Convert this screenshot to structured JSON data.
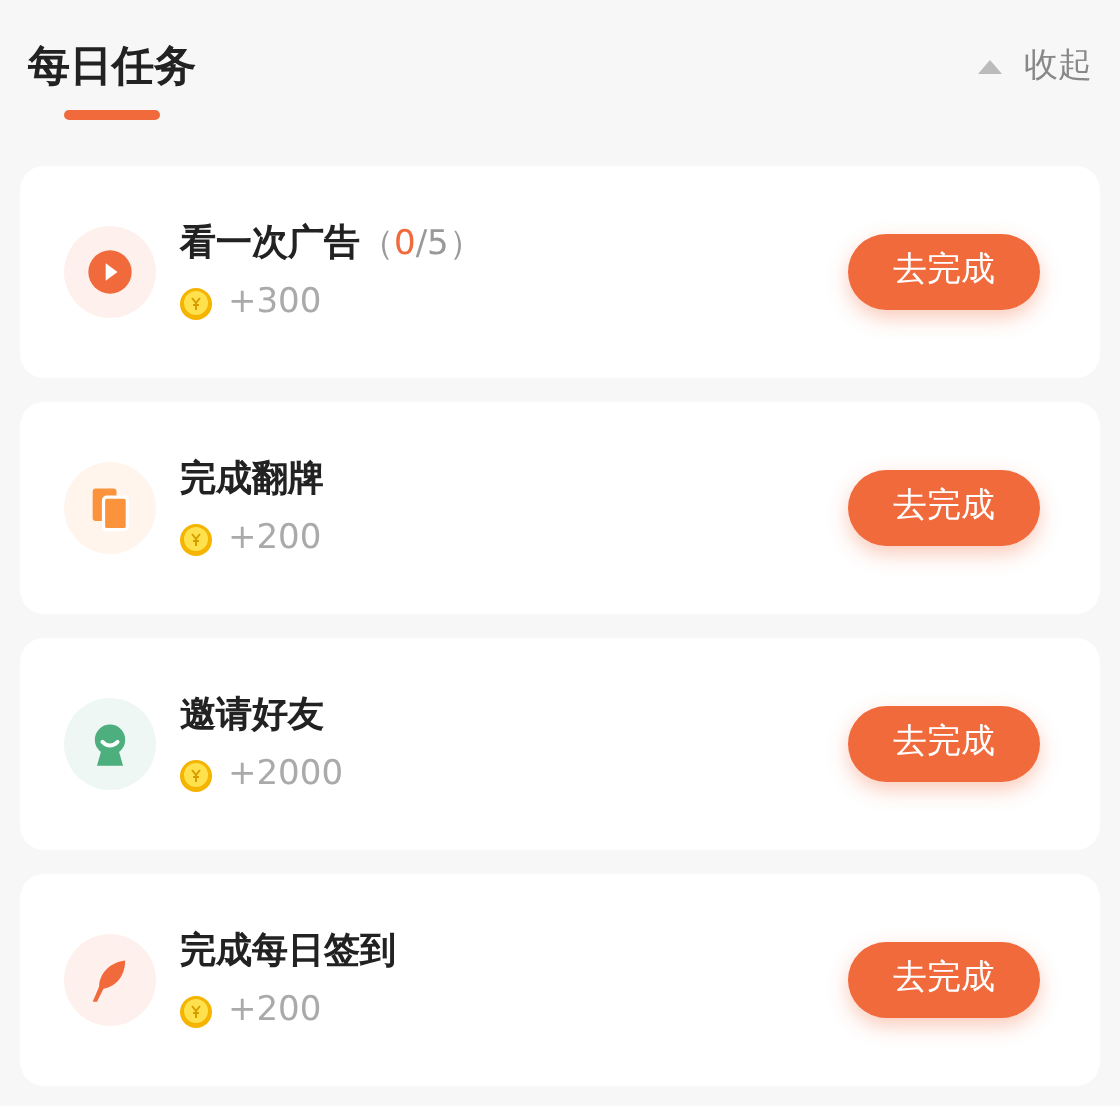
{
  "header": {
    "title": "每日任务",
    "collapse": "收起"
  },
  "tasks": [
    {
      "kind": "play",
      "color": "#f06a3c",
      "title": "看一次广告",
      "progress": {
        "open": "（",
        "done": "0",
        "rest": "/5）"
      },
      "reward": "+300",
      "button": "去完成"
    },
    {
      "kind": "cards",
      "color": "#fb923c",
      "title": "完成翻牌",
      "reward": "+200",
      "button": "去完成"
    },
    {
      "kind": "friend",
      "color": "#4caf7d",
      "title": "邀请好友",
      "reward": "+2000",
      "button": "去完成"
    },
    {
      "kind": "feather",
      "color": "#f06a3c",
      "title": "完成每日签到",
      "reward": "+200",
      "button": "去完成"
    }
  ]
}
